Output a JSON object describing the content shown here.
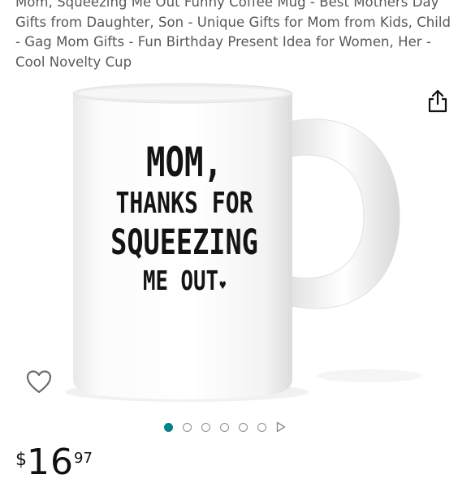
{
  "product": {
    "title": "Mom, Squeezing Me Out Funny Coffee Mug - Best Mothers Day Gifts from Daughter, Son - Unique Gifts for Mom from Kids, Child - Gag Mom Gifts - Fun Birthday Present Idea for Women, Her - Cool Novelty Cup",
    "mug_print": {
      "line1": "MOM,",
      "line2": "THANKS FOR",
      "line3": "SQUEEZING",
      "line4": "ME OUT",
      "heart": "♥"
    }
  },
  "carousel": {
    "total_images": 6,
    "active_index": 0,
    "has_video": true
  },
  "price": {
    "symbol": "$",
    "whole": "16",
    "fraction": "97"
  },
  "icons": {
    "share": "share-icon",
    "wishlist": "heart-outline-icon",
    "video": "play-triangle-icon"
  },
  "colors": {
    "title_text": "#565959",
    "active_dot": "#00808a",
    "inactive_dot": "#8c8c8c",
    "price_text": "#0f1111"
  }
}
